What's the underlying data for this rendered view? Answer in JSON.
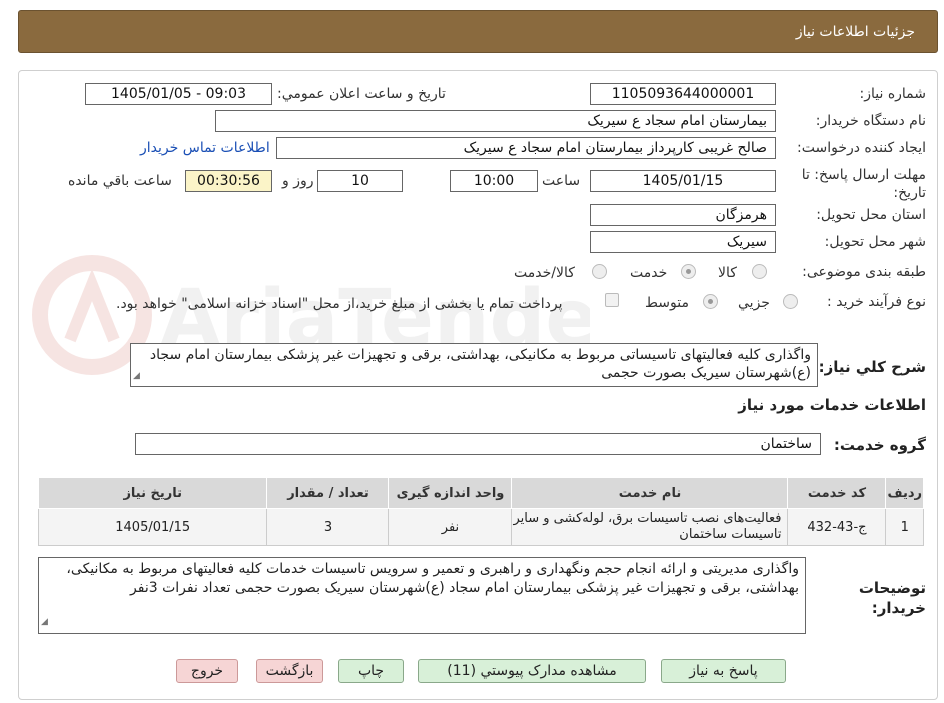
{
  "header": {
    "title": "جزئیات اطلاعات نیاز"
  },
  "labels": {
    "need_number": "شماره نیاز:",
    "announce_datetime": "تاریخ و ساعت اعلان عمومي:",
    "buyer_org": "نام دستگاه خریدار:",
    "requester": "ایجاد کننده درخواست:",
    "contact_link": "اطلاعات تماس خریدار",
    "deadline": "مهلت ارسال پاسخ: تا تاریخ:",
    "time_word": "ساعت",
    "day_and": "روز و",
    "remaining": "ساعت باقي مانده",
    "province": "استان محل تحویل:",
    "city": "شهر محل تحویل:",
    "category": "طبقه بندی موضوعی:",
    "purchase_process": "نوع فرآیند خرید :",
    "general_desc": "شرح کلي نیاز:",
    "services_info": "اطلاعات خدمات مورد نیاز",
    "service_group": "گروه خدمت:",
    "buyer_notes": "توضیحات خریدار:"
  },
  "values": {
    "need_number": "1105093644000001",
    "announce_datetime": "1405/01/05 - 09:03",
    "buyer_org": "بیمارستان امام سجاد  ع  سیریک",
    "requester": "صالح غریبی کارپرداز بیمارستان امام سجاد  ع  سیریک",
    "deadline_date": "1405/01/15",
    "deadline_time": "10:00",
    "days": "10",
    "remaining_time": "00:30:56",
    "province": "هرمزگان",
    "city": "سیریک",
    "general_desc": "واگذاری کلیه فعالیتهای تاسیساتی مربوط به مکانیکی، بهداشتی، برقی و تجهیزات غیر پزشکی بیمارستان امام سجاد (ع)شهرستان سیریک بصورت حجمی",
    "service_group": "ساختمان",
    "buyer_notes": "واگذاری مدیریتی و ارائه انجام حجم ونگهداری و راهبری و تعمیر و سرویس تاسیسات خدمات کلیه فعالیتهای مربوط به مکانیکی، بهداشتی، برقی و تجهیزات غیر پزشکی بیمارستان امام سجاد (ع)شهرستان سیریک بصورت حجمی تعداد نفرات 3نفر"
  },
  "category_options": [
    {
      "label": "کالا",
      "selected": false
    },
    {
      "label": "خدمت",
      "selected": true
    },
    {
      "label": "کالا/خدمت",
      "selected": false
    }
  ],
  "process_options": [
    {
      "label": "جزيي",
      "selected": false
    },
    {
      "label": "متوسط",
      "selected": true
    }
  ],
  "payment_note": "پرداخت تمام یا بخشی از مبلغ خرید،از محل \"اسناد خزانه اسلامی\" خواهد بود.",
  "table": {
    "headers": [
      "ردیف",
      "کد خدمت",
      "نام خدمت",
      "واحد اندازه گیری",
      "تعداد / مقدار",
      "تاریخ نیاز"
    ],
    "rows": [
      [
        "1",
        "ج-43-432",
        "فعالیت‌های نصب تاسیسات برق، لوله‌کشی و سایر تاسیسات ساختمان",
        "نفر",
        "3",
        "1405/01/15"
      ]
    ]
  },
  "buttons": {
    "reply": "پاسخ به نیاز",
    "attachments": "مشاهده مدارک پیوستي (11)",
    "print": "چاپ",
    "back": "بازگشت",
    "exit": "خروج"
  },
  "watermark": "AriaTender.neT",
  "colors": {
    "header": "#8a6a3e",
    "button_green": "#d8f0d8",
    "button_pink": "#f6d5d5",
    "remaining_bg": "#fbf4c8"
  }
}
